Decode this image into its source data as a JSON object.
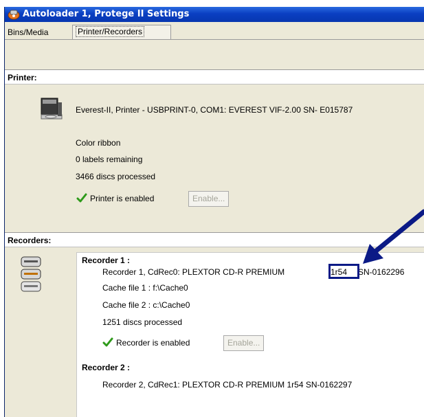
{
  "window": {
    "title": "Autoloader 1, Protege II Settings",
    "tabs": [
      {
        "label": "Bins/Media",
        "active": false
      },
      {
        "label": "Printer/Recorders",
        "active": true
      }
    ]
  },
  "printer": {
    "section_title": "Printer:",
    "device_line": "Everest-II, Printer - USBPRINT-0, COM1: EVEREST VIF-2.00 SN- E015787",
    "ribbon": "Color ribbon",
    "labels_remaining": "0 labels remaining",
    "discs_processed": "3466 discs processed",
    "status": "Printer is enabled",
    "enable_button": "Enable..."
  },
  "recorders": {
    "section_title": "Recorders:",
    "items": [
      {
        "heading": "Recorder 1 :",
        "device_prefix": "Recorder 1, CdRec0: PLEXTOR CD-R   PREMIUM ",
        "firmware": "1r54",
        "serial": "SN-0162296",
        "cache1": "Cache file 1 : f:\\Cache0",
        "cache2": "Cache file 2 : c:\\Cache0",
        "discs_processed": "1251 discs processed",
        "status": "Recorder is enabled",
        "enable_button": "Enable..."
      },
      {
        "heading": "Recorder 2 :",
        "device_line": "Recorder 2, CdRec1: PLEXTOR CD-R   PREMIUM  1r54 SN-0162297"
      }
    ]
  },
  "colors": {
    "titlebar": "#0a3fc2",
    "panel": "#ece9d8",
    "annotation": "#0b1a86",
    "check": "#2e9a1a"
  }
}
